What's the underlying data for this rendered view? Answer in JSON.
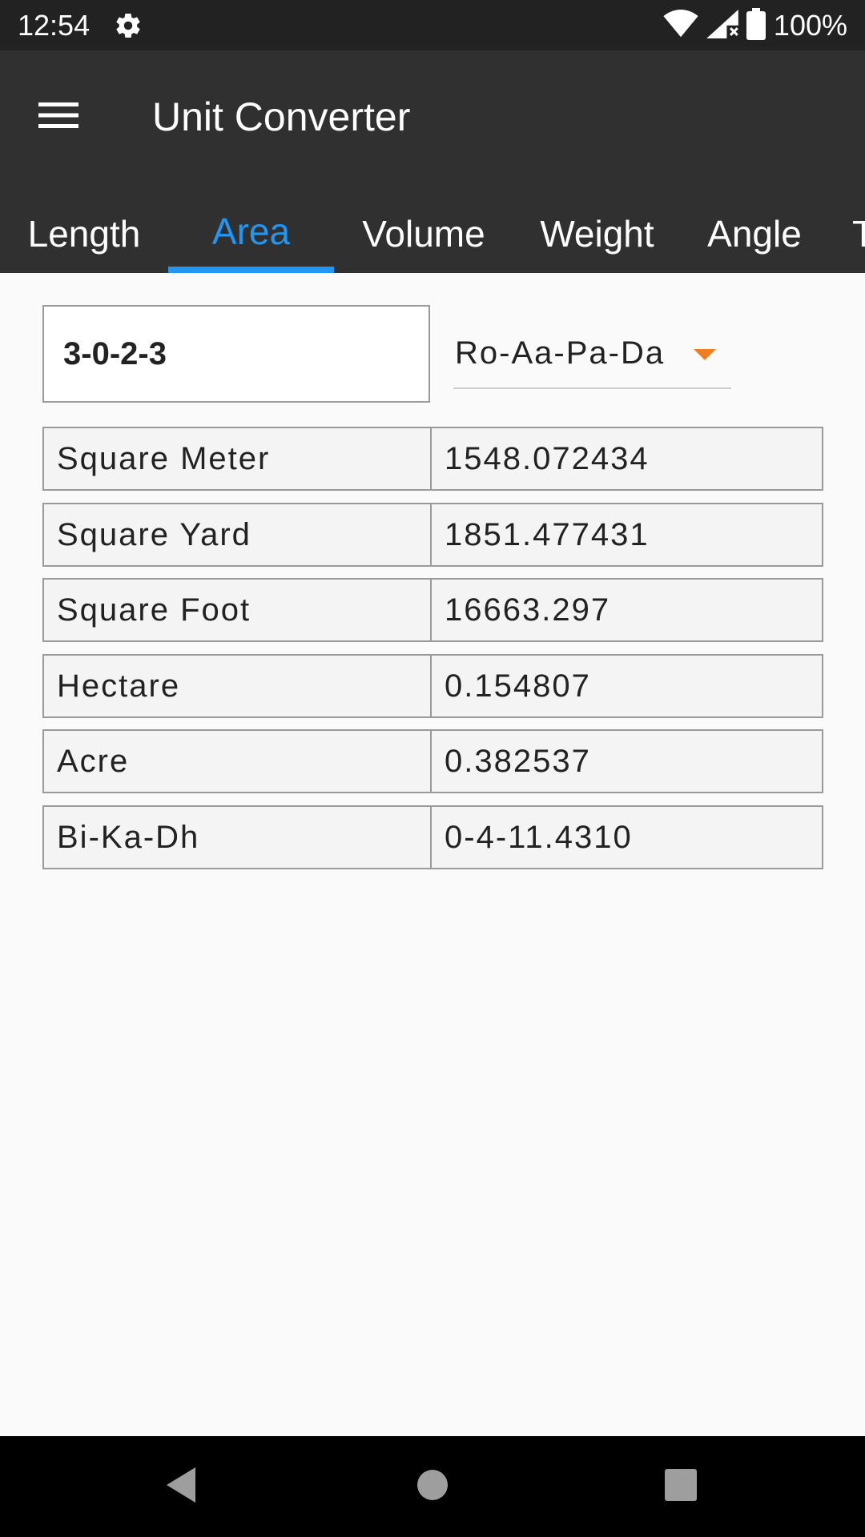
{
  "status_bar": {
    "time": "12:54",
    "battery": "100%",
    "icons": [
      "gear-icon",
      "wifi-icon",
      "signal-icon",
      "battery-icon"
    ]
  },
  "app_bar": {
    "title": "Unit Converter",
    "menu_icon": "hamburger-menu-icon"
  },
  "tabs": [
    {
      "label": "Length",
      "active": false
    },
    {
      "label": "Area",
      "active": true
    },
    {
      "label": "Volume",
      "active": false
    },
    {
      "label": "Weight",
      "active": false
    },
    {
      "label": "Angle",
      "active": false
    },
    {
      "label": "T",
      "active": false
    }
  ],
  "converter": {
    "input_value": "3-0-2-3",
    "selected_unit": "Ro-Aa-Pa-Da"
  },
  "results": [
    {
      "unit": "Square Meter",
      "value": "1548.072434"
    },
    {
      "unit": "Square Yard",
      "value": "1851.477431"
    },
    {
      "unit": "Square Foot",
      "value": "16663.297"
    },
    {
      "unit": "Hectare",
      "value": "0.154807"
    },
    {
      "unit": "Acre",
      "value": "0.382537"
    },
    {
      "unit": "Bi-Ka-Dh",
      "value": "0-4-11.4310"
    }
  ],
  "nav_bar": {
    "icons": [
      "back-icon",
      "home-icon",
      "recents-icon"
    ]
  },
  "colors": {
    "accent": "#2196f3",
    "dropdown_arrow": "#ef7d22",
    "app_bar": "#303030",
    "status_bar": "#222222",
    "background": "#fafafa"
  }
}
